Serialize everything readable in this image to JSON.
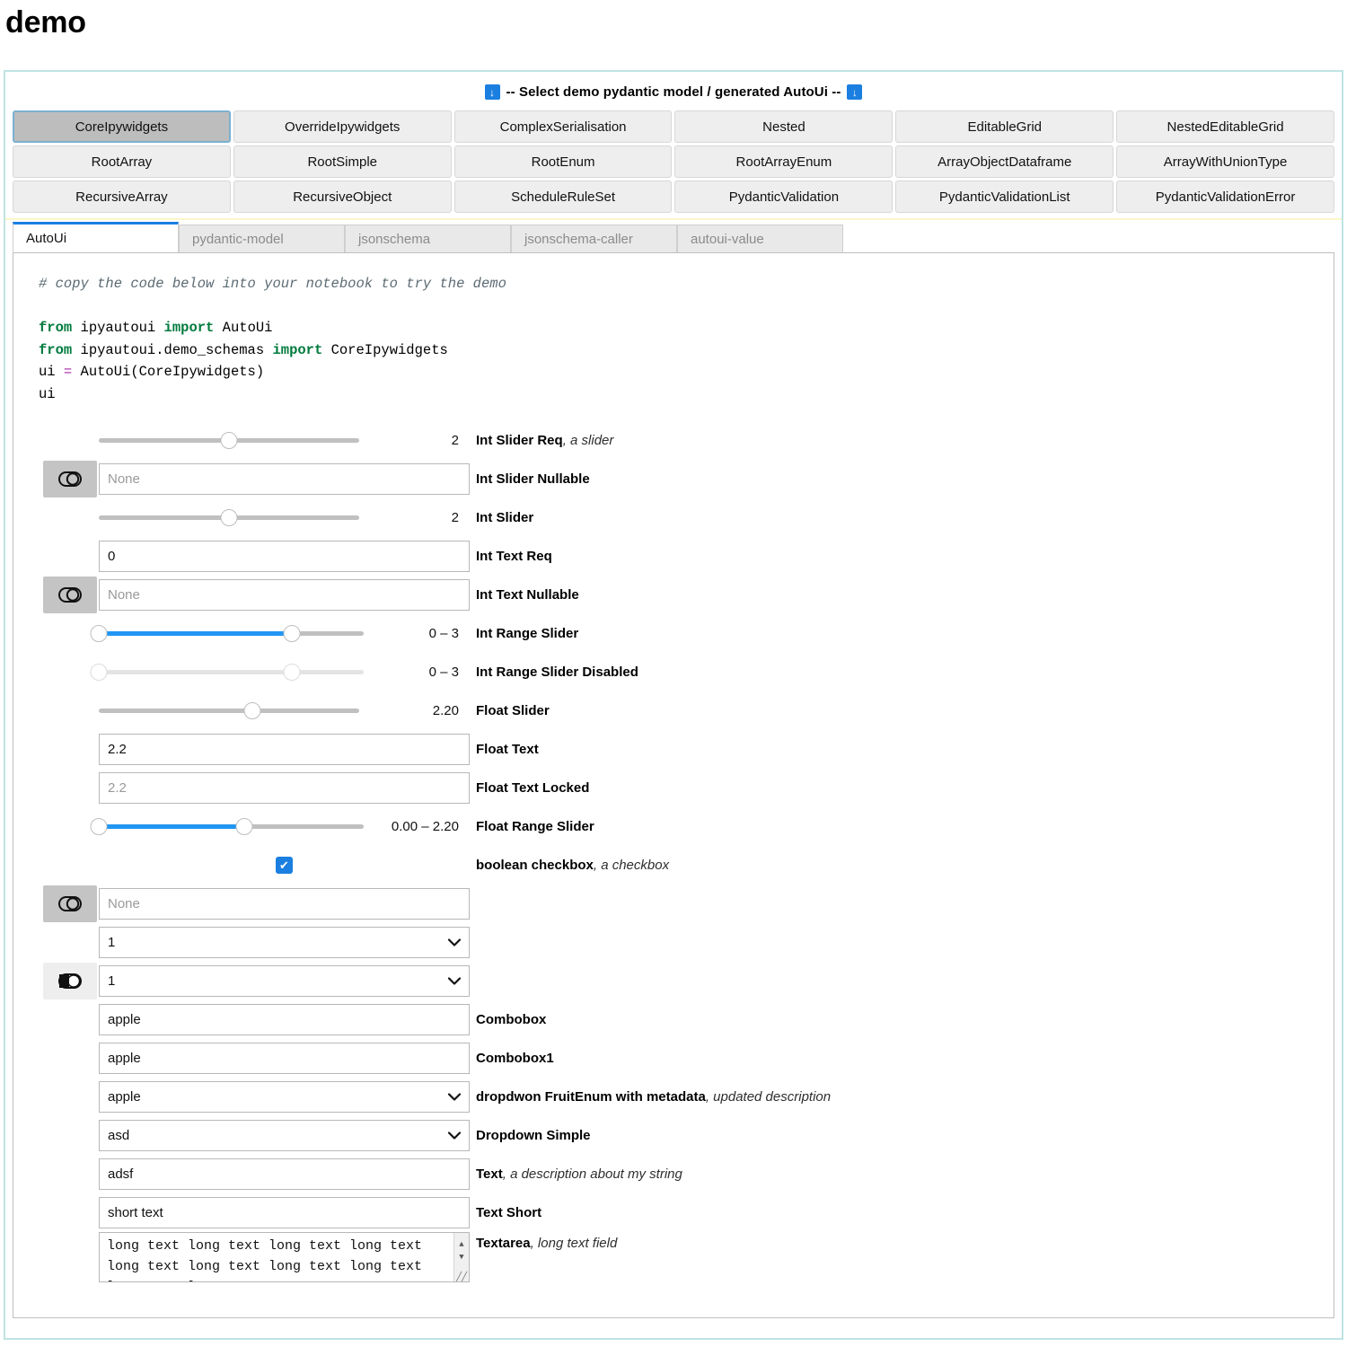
{
  "page": {
    "title": "demo"
  },
  "model_select": {
    "header_text": "-- Select demo pydantic model / generated AutoUi --",
    "icon_left": "download-icon",
    "icon_right": "download-icon",
    "icon_glyph": "↓",
    "active_button": "CoreIpywidgets",
    "buttons": [
      "CoreIpywidgets",
      "OverrideIpywidgets",
      "ComplexSerialisation",
      "Nested",
      "EditableGrid",
      "NestedEditableGrid",
      "RootArray",
      "RootSimple",
      "RootEnum",
      "RootArrayEnum",
      "ArrayObjectDataframe",
      "ArrayWithUnionType",
      "RecursiveArray",
      "RecursiveObject",
      "ScheduleRuleSet",
      "PydanticValidation",
      "PydanticValidationList",
      "PydanticValidationError"
    ]
  },
  "tabs": {
    "active": "AutoUi",
    "items": [
      "AutoUi",
      "pydantic-model",
      "jsonschema",
      "jsonschema-caller",
      "autoui-value"
    ]
  },
  "code": {
    "comment": "# copy the code below into your notebook to try the demo",
    "blank": "",
    "line1_kw": "from",
    "line1_rest1": " ipyautoui ",
    "line1_kw2": "import",
    "line1_rest2": " AutoUi",
    "line2_kw": "from",
    "line2_rest1": " ipyautoui.demo_schemas ",
    "line2_kw2": "import",
    "line2_rest2": " CoreIpywidgets",
    "line3_a": "ui ",
    "line3_op": "=",
    "line3_b": " AutoUi(CoreIpywidgets)",
    "line4": "ui"
  },
  "widgets": [
    {
      "type": "slider",
      "name": "int-slider-req",
      "label": "Int Slider Req",
      "desc": ", a slider",
      "readout": "2",
      "fraction": 0.5,
      "disabled": false,
      "filled": false
    },
    {
      "type": "nullable-text",
      "name": "int-slider-nullable",
      "label": "Int Slider Nullable",
      "desc": "",
      "value": "",
      "placeholder": "None",
      "toggle": "toggle-off-icon",
      "toggle_state": "off"
    },
    {
      "type": "slider",
      "name": "int-slider",
      "label": "Int Slider",
      "desc": "",
      "readout": "2",
      "fraction": 0.5,
      "disabled": false,
      "filled": false
    },
    {
      "type": "text",
      "name": "int-text-req",
      "label": "Int Text Req",
      "desc": "",
      "value": "0",
      "placeholder": ""
    },
    {
      "type": "nullable-text",
      "name": "int-text-nullable",
      "label": "Int Text Nullable",
      "desc": "",
      "value": "",
      "placeholder": "None",
      "toggle": "toggle-off-icon",
      "toggle_state": "off"
    },
    {
      "type": "range-slider",
      "name": "int-range-slider",
      "label": "Int Range Slider",
      "desc": "",
      "readout": "0 – 3",
      "low": 0.0,
      "high": 0.73,
      "disabled": false
    },
    {
      "type": "range-slider",
      "name": "int-range-slider-disabled",
      "label": "Int Range Slider Disabled",
      "desc": "",
      "readout": "0 – 3",
      "low": 0.0,
      "high": 0.73,
      "disabled": true
    },
    {
      "type": "slider",
      "name": "float-slider",
      "label": "Float Slider",
      "desc": "",
      "readout": "2.20",
      "fraction": 0.59,
      "disabled": false,
      "filled": false
    },
    {
      "type": "text",
      "name": "float-text",
      "label": "Float Text",
      "desc": "",
      "value": "2.2",
      "placeholder": ""
    },
    {
      "type": "text-locked",
      "name": "float-text-locked",
      "label": "Float Text Locked",
      "desc": "",
      "value": "2.2",
      "placeholder": ""
    },
    {
      "type": "range-slider",
      "name": "float-range-slider",
      "label": "Float Range Slider",
      "desc": "",
      "readout": "0.00 – 2.20",
      "low": 0.0,
      "high": 0.55,
      "disabled": false
    },
    {
      "type": "checkbox",
      "name": "boolean-checkbox",
      "label": "boolean checkbox",
      "desc": ", a checkbox",
      "checked": true,
      "glyph": "✔"
    },
    {
      "type": "nullable-text",
      "name": "nullable-select",
      "label": "",
      "desc": "",
      "value": "",
      "placeholder": "None",
      "toggle": "toggle-off-icon",
      "toggle_state": "off"
    },
    {
      "type": "select",
      "name": "select-one",
      "label": "",
      "desc": "",
      "value": "1",
      "chevron": "chevron-down-icon"
    },
    {
      "type": "nullable-select",
      "name": "nullable-select-two",
      "label": "",
      "desc": "",
      "value": "1",
      "chevron": "chevron-down-icon",
      "toggle": "toggle-on-icon",
      "toggle_state": "on"
    },
    {
      "type": "text",
      "name": "combobox",
      "label": "Combobox",
      "desc": "",
      "value": "apple",
      "placeholder": ""
    },
    {
      "type": "text",
      "name": "combobox1",
      "label": "Combobox1",
      "desc": "",
      "value": "apple",
      "placeholder": ""
    },
    {
      "type": "select",
      "name": "dropdown-fruitenum-metadata",
      "label": "dropdwon FruitEnum with metadata",
      "desc": ", updated description",
      "value": "apple",
      "chevron": "chevron-down-icon"
    },
    {
      "type": "select",
      "name": "dropdown-simple",
      "label": "Dropdown Simple",
      "desc": "",
      "value": "asd",
      "chevron": "chevron-down-icon"
    },
    {
      "type": "text",
      "name": "text",
      "label": "Text",
      "desc": ", a description about my string",
      "value": "adsf",
      "placeholder": ""
    },
    {
      "type": "text",
      "name": "text-short",
      "label": "Text Short",
      "desc": "",
      "value": "short text",
      "placeholder": ""
    },
    {
      "type": "textarea",
      "name": "textarea",
      "label": "Textarea",
      "desc": ", long text field",
      "value": "long text long text long text long text long text long text long text long text long text long text",
      "scroll_up": "▲",
      "scroll_down": "▼",
      "grip": "╱╱"
    }
  ]
}
